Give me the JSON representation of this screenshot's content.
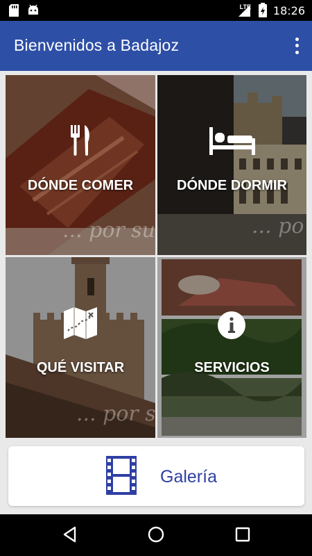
{
  "status_bar": {
    "time": "18:26",
    "network": "LTE",
    "icons": [
      "sd-card-icon",
      "android-icon",
      "signal-icon",
      "battery-icon"
    ]
  },
  "app_bar": {
    "title": "Bienvenidos a Badajoz",
    "menu_icon": "more-vert-icon"
  },
  "tiles": [
    {
      "label": "DÓNDE COMER",
      "icon": "fork-knife-icon",
      "watermark": "... por su"
    },
    {
      "label": "DÓNDE DORMIR",
      "icon": "bed-icon",
      "watermark": "... po"
    },
    {
      "label": "QUÉ VISITAR",
      "icon": "map-icon",
      "watermark": "... por su"
    },
    {
      "label": "SERVICIOS",
      "icon": "info-icon"
    }
  ],
  "gallery": {
    "label": "Galería",
    "icon": "film-icon"
  },
  "nav_bar": {
    "buttons": [
      "back-icon",
      "home-icon",
      "recents-icon"
    ]
  },
  "colors": {
    "app_bar": "#2e4fa6",
    "gallery_text": "#2e3fa3",
    "background": "#e9e9e9"
  }
}
